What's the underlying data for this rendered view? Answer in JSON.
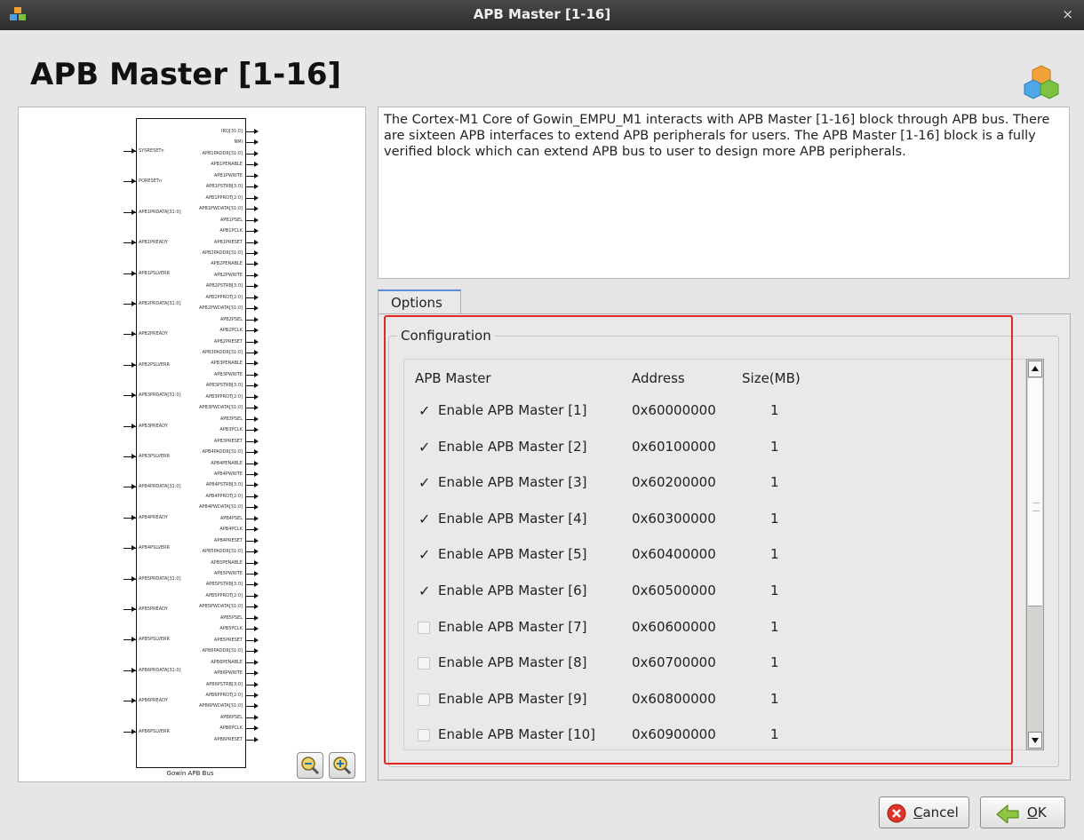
{
  "window": {
    "title": "APB Master [1-16]",
    "close": "×"
  },
  "page_title": "APB Master [1-16]",
  "description": "The Cortex-M1 Core of Gowin_EMPU_M1 interacts with APB Master [1-16] block through APB bus. There are sixteen APB interfaces to extend APB peripherals for users. The APB Master [1-16] block is a fully verified block which can extend APB bus to user to design more APB peripherals.",
  "diagram": {
    "block_name": "Gowin APB Bus",
    "left_pins": [
      "SYSRESETn",
      "PORESETn",
      "APB1PRDATA[31:0]",
      "APB1PREADY",
      "APB1PSLVERR",
      "APB2PRDATA[31:0]",
      "APB2PREADY",
      "APB2PSLVERR",
      "APB3PRDATA[31:0]",
      "APB3PREADY",
      "APB3PSLVERR",
      "APB4PRDATA[31:0]",
      "APB4PREADY",
      "APB4PSLVERR",
      "APB5PRDATA[31:0]",
      "APB5PREADY",
      "APB5PSLVERR",
      "APB6PRDATA[31:0]",
      "APB6PREADY",
      "APB6PSLVERR"
    ],
    "right_pins": [
      "IRQ[31:0]",
      "NMI",
      "APB1PADDR[31:0]",
      "APB1PENABLE",
      "APB1PWRITE",
      "APB1PSTRB[3:0]",
      "APB1PPROT[2:0]",
      "APB1PWDATA[31:0]",
      "APB1PSEL",
      "APB1PCLK",
      "APB1PRESET",
      "APB2PADDR[31:0]",
      "APB2PENABLE",
      "APB2PWRITE",
      "APB2PSTRB[3:0]",
      "APB2PPROT[2:0]",
      "APB2PWDATA[31:0]",
      "APB2PSEL",
      "APB2PCLK",
      "APB2PRESET",
      "APB3PADDR[31:0]",
      "APB3PENABLE",
      "APB3PWRITE",
      "APB3PSTRB[3:0]",
      "APB3PPROT[2:0]",
      "APB3PWDATA[31:0]",
      "APB3PSEL",
      "APB3PCLK",
      "APB3PRESET",
      "APB4PADDR[31:0]",
      "APB4PENABLE",
      "APB4PWRITE",
      "APB4PSTRB[3:0]",
      "APB4PPROT[2:0]",
      "APB4PWDATA[31:0]",
      "APB4PSEL",
      "APB4PCLK",
      "APB4PRESET",
      "APB5PADDR[31:0]",
      "APB5PENABLE",
      "APB5PWRITE",
      "APB5PSTRB[3:0]",
      "APB5PPROT[2:0]",
      "APB5PWDATA[31:0]",
      "APB5PSEL",
      "APB5PCLK",
      "APB5PRESET",
      "APB6PADDR[31:0]",
      "APB6PENABLE",
      "APB6PWRITE",
      "APB6PSTRB[3:0]",
      "APB6PPROT[2:0]",
      "APB6PWDATA[31:0]",
      "APB6PSEL",
      "APB6PCLK",
      "APB6PRESET"
    ],
    "zoom_out_icon": "zoom-out-icon",
    "zoom_in_icon": "zoom-in-icon"
  },
  "tabs": [
    {
      "label": "Options",
      "active": true
    }
  ],
  "configuration": {
    "group_label": "Configuration",
    "headers": {
      "master": "APB Master",
      "address": "Address",
      "size": "Size(MB)"
    },
    "rows": [
      {
        "label": "Enable APB Master [1]",
        "checked": true,
        "address": "0x60000000",
        "size": "1"
      },
      {
        "label": "Enable APB Master [2]",
        "checked": true,
        "address": "0x60100000",
        "size": "1"
      },
      {
        "label": "Enable APB Master [3]",
        "checked": true,
        "address": "0x60200000",
        "size": "1"
      },
      {
        "label": "Enable APB Master [4]",
        "checked": true,
        "address": "0x60300000",
        "size": "1"
      },
      {
        "label": "Enable APB Master [5]",
        "checked": true,
        "address": "0x60400000",
        "size": "1"
      },
      {
        "label": "Enable APB Master [6]",
        "checked": true,
        "address": "0x60500000",
        "size": "1"
      },
      {
        "label": "Enable APB Master [7]",
        "checked": false,
        "address": "0x60600000",
        "size": "1"
      },
      {
        "label": "Enable APB Master [8]",
        "checked": false,
        "address": "0x60700000",
        "size": "1"
      },
      {
        "label": "Enable APB Master [9]",
        "checked": false,
        "address": "0x60800000",
        "size": "1"
      },
      {
        "label": "Enable APB Master [10]",
        "checked": false,
        "address": "0x60900000",
        "size": "1"
      }
    ]
  },
  "buttons": {
    "cancel": {
      "mnemonic": "C",
      "rest": "ancel",
      "icon": "cancel-icon"
    },
    "ok": {
      "mnemonic": "O",
      "rest": "K",
      "icon": "ok-icon"
    }
  },
  "colors": {
    "highlight_box": "#e02828",
    "titlebar": "#333333",
    "tab_accent": "#5a8fd8"
  }
}
